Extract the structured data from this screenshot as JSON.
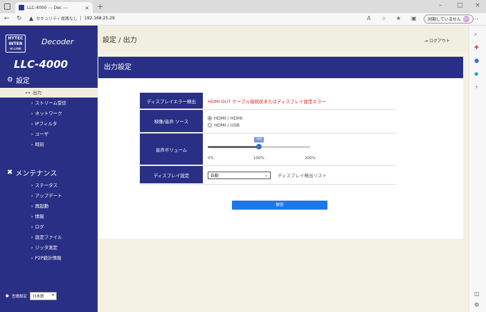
{
  "browser": {
    "tab_title": "LLC-4000 --- Dec ---",
    "tab_close": "×",
    "new_tab": "+",
    "security": "セキュリティ保護なし",
    "host": "192.168.25.29",
    "sync_label": "同期していません",
    "profile": "WT",
    "minimize": "–",
    "maximize": "□",
    "close": "×",
    "more": "…"
  },
  "sidebar": {
    "logo_line1": "HYTEC",
    "logo_line2": "INTER",
    "logo_small": "HI-LINK",
    "app": "Decoder",
    "model": "LLC-4000",
    "settings_header": "設定",
    "settings_items": [
      {
        "label": "出力",
        "arrow": "»»"
      },
      {
        "label": "ストリーム受信",
        "arrow": "›"
      },
      {
        "label": "ネットワーク",
        "arrow": "›"
      },
      {
        "label": "IPフィルタ",
        "arrow": "›"
      },
      {
        "label": "ユーザ",
        "arrow": "›"
      },
      {
        "label": "時刻",
        "arrow": "›"
      }
    ],
    "maint_header": "メンテナンス",
    "maint_items": [
      {
        "label": "ステータス",
        "arrow": "›"
      },
      {
        "label": "アップデート",
        "arrow": "›"
      },
      {
        "label": "再起動",
        "arrow": "›"
      },
      {
        "label": "情報",
        "arrow": "›"
      },
      {
        "label": "ログ",
        "arrow": "›"
      },
      {
        "label": "設定ファイル",
        "arrow": "›"
      },
      {
        "label": "ジッタ測定",
        "arrow": "›"
      },
      {
        "label": "P2P統計情報",
        "arrow": "›"
      }
    ],
    "lang_label": "言語設定",
    "lang_value": "日本語"
  },
  "header": {
    "breadcrumb": "設定 / 出力",
    "logout": "ログアウト"
  },
  "panel": {
    "title": "出力設定",
    "rows": {
      "error_label": "ディスプレイエラー検出",
      "error_value": "HDMI OUT ケーブル接続状またはディスプレイ設定エラー",
      "source_label": "映像/音声 ソース",
      "source_options": [
        "HDMI / HDMI",
        "HDMI / USB"
      ],
      "source_selected": 0,
      "volume_label": "音声ボリューム",
      "volume_value": "100",
      "volume_fraction": 0.5,
      "volume_ticks": [
        "0%",
        "100%",
        "200%"
      ],
      "display_label": "ディスプレイ設定",
      "display_value": "自動",
      "display_link": "ディスプレイ検出リスト"
    },
    "save": "保存"
  }
}
